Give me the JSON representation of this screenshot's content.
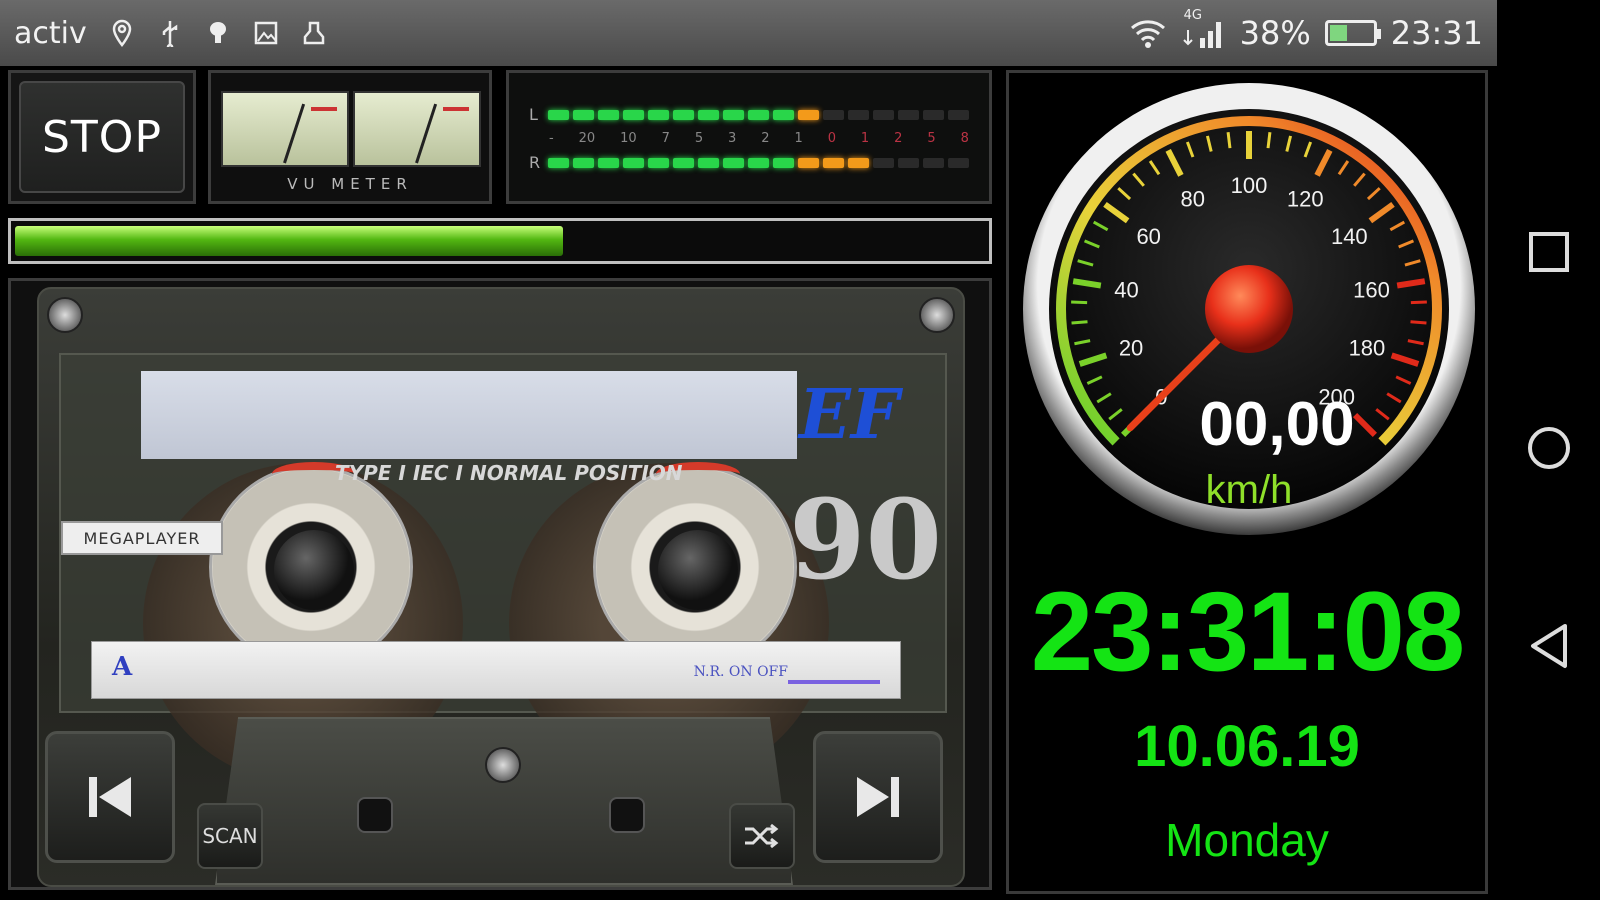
{
  "statusbar": {
    "carrier": "activ",
    "network": "4G",
    "battery_text": "38%",
    "battery_level": 0.38,
    "time": "23:31",
    "icons": [
      "location-icon",
      "usb-icon",
      "android-debug-icon",
      "image-icon",
      "cleaning-icon",
      "wifi-icon",
      "signal-icon",
      "battery-icon"
    ]
  },
  "player": {
    "stop_label": "STOP",
    "vu_label": "VU METER",
    "level_meter": {
      "channels": [
        "L",
        "R"
      ],
      "scale": [
        "-",
        "20",
        "10",
        "7",
        "5",
        "3",
        "2",
        "1",
        "0",
        "1",
        "2",
        "5",
        "8"
      ],
      "left_level": 11,
      "right_level": 13
    },
    "progress": 0.56
  },
  "cassette": {
    "brand_logo": "EF",
    "type_text": "TYPE I IEC I NORMAL POSITION",
    "length": "90",
    "sticker": "MEGAPLAYER",
    "side": "A",
    "nr_text": "N.R. ON OFF",
    "scan_label": "SCAN"
  },
  "speedometer": {
    "speed": "00,00",
    "unit": "km/h",
    "ticks": [
      "0",
      "20",
      "40",
      "60",
      "80",
      "100",
      "120",
      "140",
      "160",
      "180",
      "200"
    ],
    "value": 0
  },
  "clock": {
    "time": "23:31:08",
    "date": "10.06.19",
    "day": "Monday"
  },
  "colors": {
    "clock_green": "#14e414",
    "progress_green": "#53b812",
    "level_green": "#29d64a",
    "level_orange": "#f39a1a",
    "logo_blue": "#1e4fd6",
    "needle_red": "#e8401a"
  }
}
